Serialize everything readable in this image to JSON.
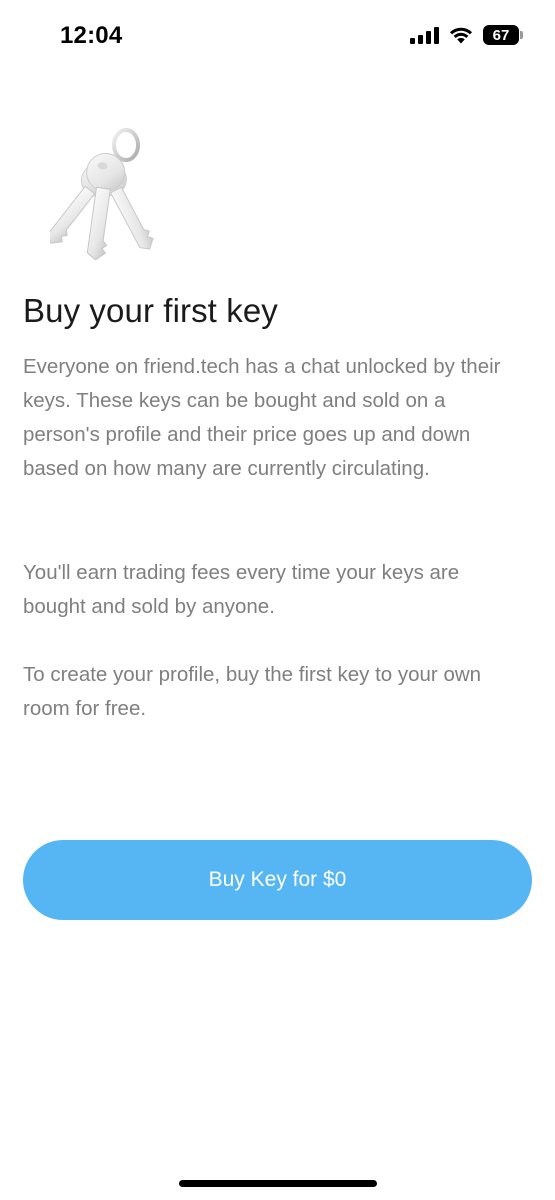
{
  "status_bar": {
    "time": "12:04",
    "battery_level": "67",
    "icons": [
      "signal-icon",
      "wifi-icon",
      "battery-icon"
    ]
  },
  "illustration": {
    "icon": "keys-icon"
  },
  "main": {
    "title": "Buy your first key",
    "paragraphs": [
      "Everyone on friend.tech has a chat unlocked by their keys. These keys can be bought and sold on a person's profile and their price goes up and down based on how many are currently circulating.",
      "You'll earn trading fees every time your keys are bought and sold by anyone.",
      "To create your profile, buy the first key to your own room for free."
    ]
  },
  "actions": {
    "buy_label": "Buy Key for $0"
  },
  "colors": {
    "accent": "#55b6f3",
    "title": "#1b1b1b",
    "body": "#7f7f7f"
  }
}
